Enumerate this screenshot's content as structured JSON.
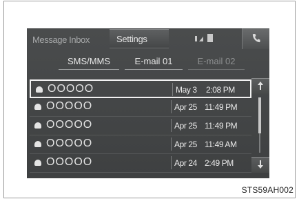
{
  "header": {
    "inbox_label": "Message Inbox",
    "settings_label": "Settings"
  },
  "tabs": [
    {
      "label": "SMS/MMS"
    },
    {
      "label": "E-mail 01"
    },
    {
      "label": "E-mail 02"
    }
  ],
  "messages": [
    {
      "sender": "OOOOO",
      "date": "May 3",
      "time": "2:08 PM"
    },
    {
      "sender": "OOOOO",
      "date": "Apr 25",
      "time": "11:49 PM"
    },
    {
      "sender": "OOOOO",
      "date": "Apr 25",
      "time": "11:49 PM"
    },
    {
      "sender": "OOOOO",
      "date": "Apr 25",
      "time": "11:49 AM"
    },
    {
      "sender": "OOOOO",
      "date": "Apr 24",
      "time": "2:49 PM"
    }
  ],
  "scroll": {
    "position": 0.0
  },
  "caption": "STS59AH002",
  "icons": {
    "phone": "phone-icon",
    "up": "up-arrow-icon",
    "down": "down-arrow-icon",
    "message": "message-icon"
  }
}
